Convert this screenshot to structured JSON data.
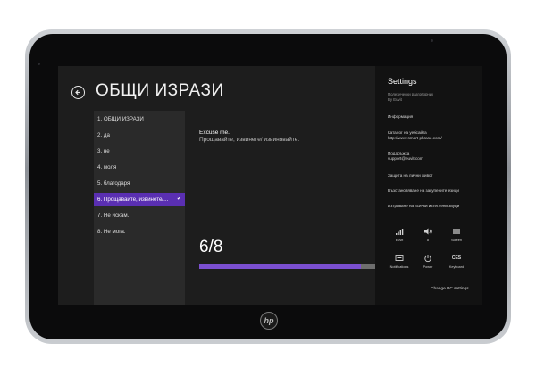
{
  "app": {
    "title": "ОБЩИ ИЗРАЗИ"
  },
  "list": {
    "items": [
      {
        "label": "1. ОБЩИ ИЗРАЗИ",
        "selected": false
      },
      {
        "label": "2. да",
        "selected": false
      },
      {
        "label": "3. не",
        "selected": false
      },
      {
        "label": "4. моля",
        "selected": false
      },
      {
        "label": "5. благодаря",
        "selected": false
      },
      {
        "label": "6. Прощавайте, извинете/...",
        "selected": true
      },
      {
        "label": "7. Не искам.",
        "selected": false
      },
      {
        "label": "8. Не мога.",
        "selected": false
      }
    ]
  },
  "phrase": {
    "english": "Excuse me.",
    "bulgarian": "Прощавайте, извинете/ извинявайте."
  },
  "progress": {
    "counter": "6/8",
    "fraction": 0.92
  },
  "settings": {
    "title": "Settings",
    "subtitle_line1": "Полезически разговорник",
    "subtitle_line2": "By Euvit",
    "info": "Информация",
    "website_label": "Каталог на уебсайта",
    "website_url": "http://www.smart-phrase.com/",
    "support_label": "Поддръжка",
    "support_email": "support@euvit.com",
    "privacy": "Защита на лични живот",
    "restore": "Възстановяване на закупените езици",
    "delete": "Изтриване на всички изтеглени звуци",
    "tiles": {
      "network": "Euvit",
      "volume": "8",
      "screen": "Screen",
      "notifications": "Notifications",
      "power": "Power",
      "keyboard_glyph": "CES",
      "keyboard": "Keyboard"
    },
    "change": "Change PC settings"
  },
  "device": {
    "brand": "hp"
  },
  "colors": {
    "accent": "#5a2fb2",
    "progress_fill": "#7b4fd1",
    "background": "#1d1d1d"
  }
}
